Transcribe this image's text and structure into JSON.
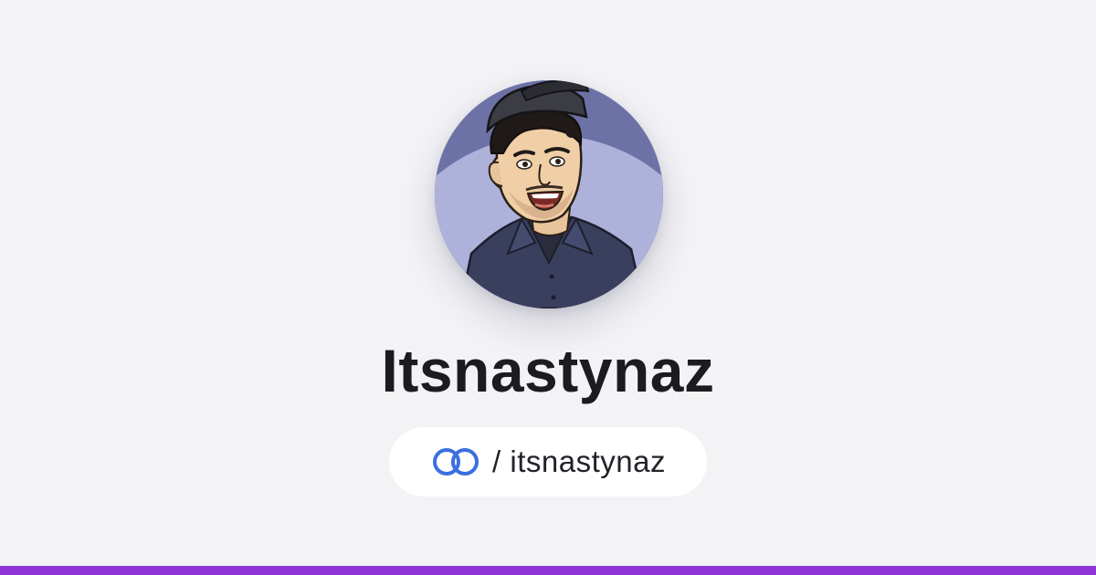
{
  "profile": {
    "display_name": "Itsnastynaz",
    "handle": "/ itsnastynaz"
  },
  "icons": {
    "avatar": "cartoon-portrait-avatar",
    "brand": "linked-rings-logo-icon"
  },
  "colors": {
    "background": "#f3f3f6",
    "brand_blue": "#3b6fe0",
    "accent_bar": "#8e35d8",
    "name_text": "#1b1b20"
  }
}
